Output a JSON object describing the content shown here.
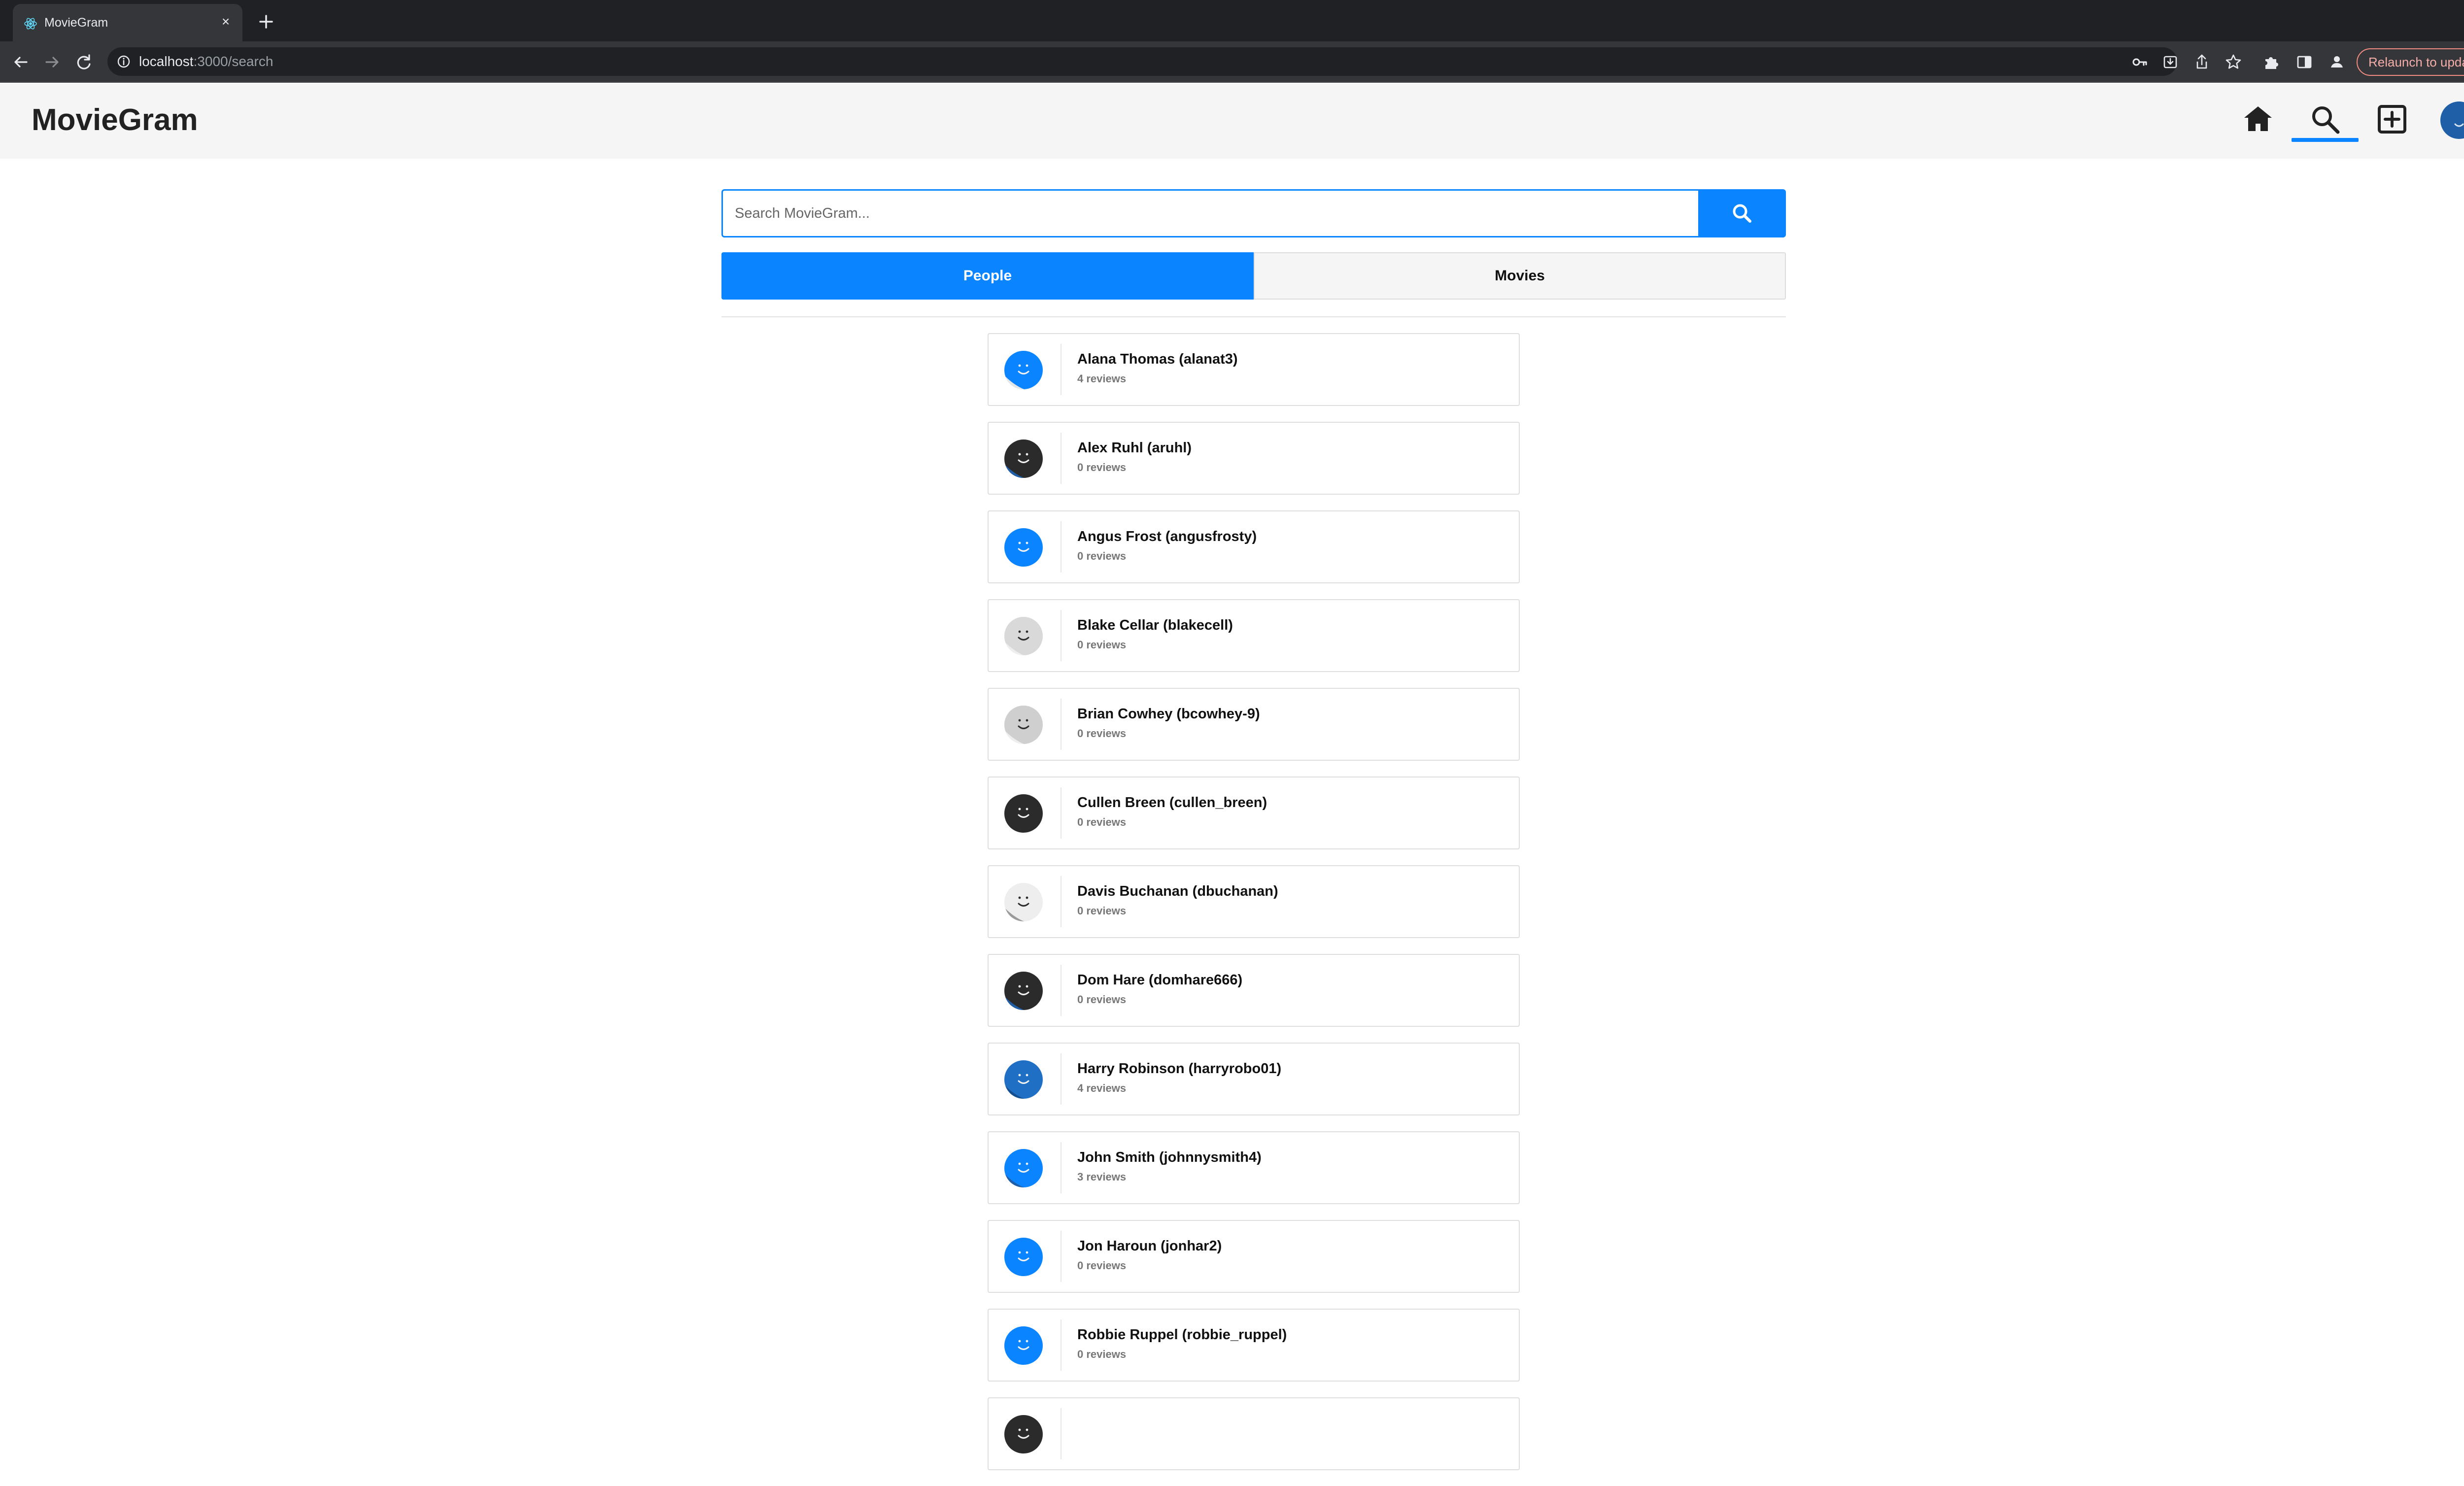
{
  "browser": {
    "tab_title": "MovieGram",
    "url_host": "localhost",
    "url_path": ":3000/search",
    "relaunch_label": "Relaunch to update",
    "accent": "#0a84ff"
  },
  "header": {
    "logo": "MovieGram",
    "icons": [
      "home-icon",
      "search-icon",
      "add-box-icon",
      "profile-avatar"
    ],
    "active": "search"
  },
  "search": {
    "placeholder": "Search MovieGram...",
    "value": ""
  },
  "tabs": [
    {
      "label": "People",
      "active": true
    },
    {
      "label": "Movies",
      "active": false
    }
  ],
  "people": [
    {
      "name": "Alana Thomas (alanat3)",
      "reviews": "4 reviews",
      "avatar_color": "#0a84ff",
      "avatar_shade": "#e6e6e6"
    },
    {
      "name": "Alex Ruhl (aruhl)",
      "reviews": "0 reviews",
      "avatar_color": "#2b2b2b",
      "avatar_shade": "#1f5fa8"
    },
    {
      "name": "Angus Frost (angusfrosty)",
      "reviews": "0 reviews",
      "avatar_color": "#0a84ff",
      "avatar_shade": "#0a84ff"
    },
    {
      "name": "Blake Cellar (blakecell)",
      "reviews": "0 reviews",
      "avatar_color": "#d9d9d9",
      "avatar_shade": "#eeeeee"
    },
    {
      "name": "Brian Cowhey (bcowhey-9)",
      "reviews": "0 reviews",
      "avatar_color": "#cfcfcf",
      "avatar_shade": "#eeeeee"
    },
    {
      "name": "Cullen Breen (cullen_breen)",
      "reviews": "0 reviews",
      "avatar_color": "#2b2b2b",
      "avatar_shade": "#2b2b2b"
    },
    {
      "name": "Davis Buchanan (dbuchanan)",
      "reviews": "0 reviews",
      "avatar_color": "#eeeeee",
      "avatar_shade": "#9a9a9a"
    },
    {
      "name": "Dom Hare (domhare666)",
      "reviews": "0 reviews",
      "avatar_color": "#2b2b2b",
      "avatar_shade": "#1f5fa8"
    },
    {
      "name": "Harry Robinson (harryrobo01)",
      "reviews": "4 reviews",
      "avatar_color": "#1f6fc4",
      "avatar_shade": "#134f91"
    },
    {
      "name": "John Smith (johnnysmith4)",
      "reviews": "3 reviews",
      "avatar_color": "#0a84ff",
      "avatar_shade": "#1f5fa8"
    },
    {
      "name": "Jon Haroun (jonhar2)",
      "reviews": "0 reviews",
      "avatar_color": "#0a84ff",
      "avatar_shade": "#0a84ff"
    },
    {
      "name": "Robbie Ruppel (robbie_ruppel)",
      "reviews": "0 reviews",
      "avatar_color": "#0a84ff",
      "avatar_shade": "#0a84ff"
    },
    {
      "name": "",
      "reviews": "",
      "avatar_color": "#2b2b2b",
      "avatar_shade": "#2b2b2b"
    }
  ]
}
